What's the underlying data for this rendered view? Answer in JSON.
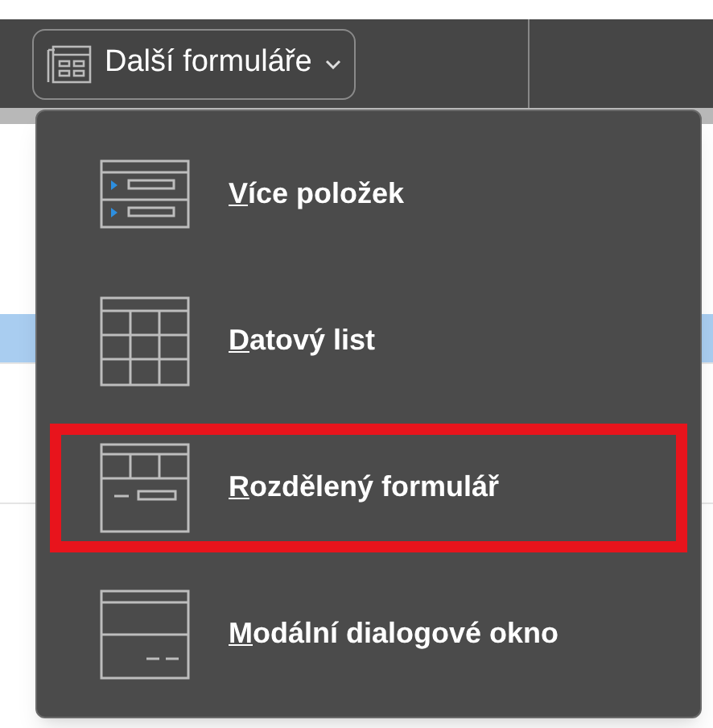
{
  "ribbon": {
    "button": {
      "label": "Další formuláře",
      "expanded": true
    }
  },
  "menu": {
    "items": [
      {
        "kind": "multiple",
        "label": "Více položek",
        "underline_first": true,
        "annotated": false
      },
      {
        "kind": "datasheet",
        "label": "Datový list",
        "underline_first": true,
        "annotated": false
      },
      {
        "kind": "split",
        "label": "Rozdělený formulář",
        "underline_first": true,
        "annotated": true
      },
      {
        "kind": "dialog",
        "label": "Modální dialogové okno",
        "underline_first": true,
        "annotated": false
      }
    ]
  }
}
